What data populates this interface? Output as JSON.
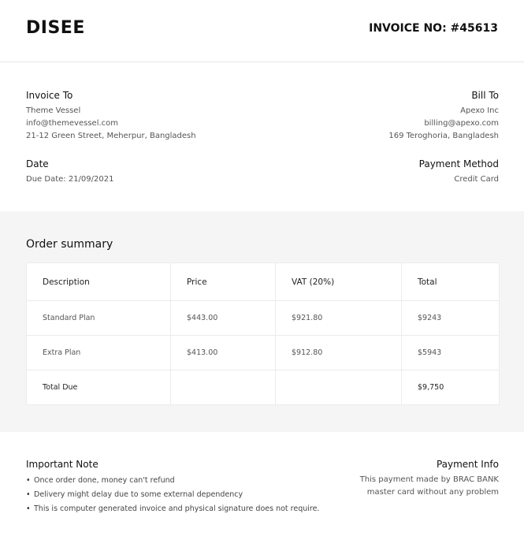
{
  "header": {
    "logo": "DISEE",
    "invoice_no": "INVOICE NO: #45613"
  },
  "invoice_to": {
    "heading": "Invoice To",
    "lines": [
      "Theme Vessel",
      "info@themevessel.com",
      "21-12 Green Street, Meherpur, Bangladesh"
    ]
  },
  "bill_to": {
    "heading": "Bill To",
    "lines": [
      "Apexo Inc",
      "billing@apexo.com",
      "169 Teroghoria, Bangladesh"
    ]
  },
  "date": {
    "heading": "Date",
    "value": "Due Date: 21/09/2021"
  },
  "payment_method": {
    "heading": "Payment Method",
    "value": "Credit Card"
  },
  "order_summary": {
    "title": "Order summary",
    "columns": [
      "Description",
      "Price",
      "VAT (20%)",
      "Total"
    ],
    "rows": [
      [
        "Standard Plan",
        "$443.00",
        "$921.80",
        "$9243"
      ],
      [
        "Extra Plan",
        "$413.00",
        "$912.80",
        "$5943"
      ],
      [
        "Total Due",
        "",
        "",
        "$9,750"
      ]
    ]
  },
  "important_note": {
    "heading": "Important Note",
    "items": [
      "Once order done, money can't refund",
      "Delivery might delay due to some external dependency",
      "This is computer generated invoice and physical signature does not require."
    ]
  },
  "payment_info": {
    "heading": "Payment Info",
    "lines": [
      "This payment made by BRAC BANK",
      "master card without any problem"
    ]
  }
}
